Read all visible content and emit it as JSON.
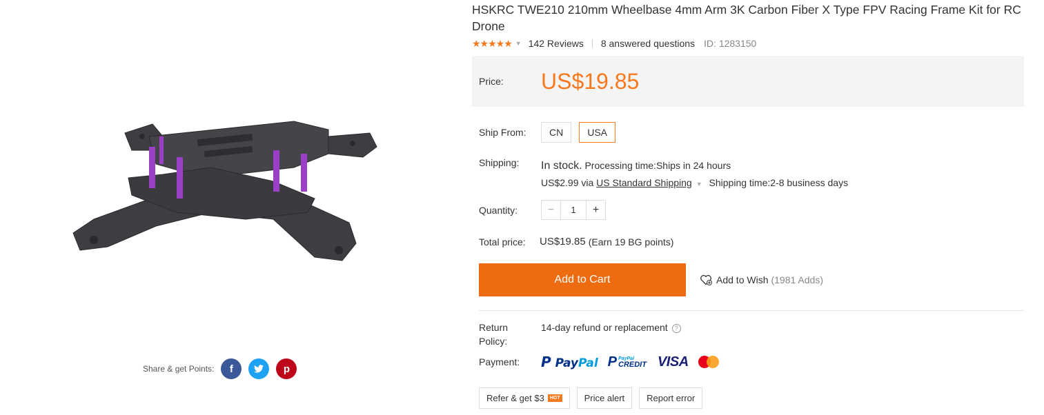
{
  "product": {
    "title": "HSKRC TWE210 210mm Wheelbase 4mm Arm 3K Carbon Fiber X Type FPV Racing Frame Kit for RC Drone",
    "stars": "★★★★★",
    "rating_value": 5,
    "reviews": "142 Reviews",
    "answered": "8 answered questions",
    "id": "ID: 1283150"
  },
  "price": {
    "label": "Price:",
    "value": "US$19.85"
  },
  "ship_from": {
    "label": "Ship From:",
    "options": [
      "CN",
      "USA"
    ],
    "selected": "USA"
  },
  "shipping": {
    "label": "Shipping:",
    "stock": "In stock.",
    "processing": "Processing time:Ships in 24 hours",
    "cost": "US$2.99 via",
    "method": "US Standard Shipping",
    "time": "Shipping time:2-8 business days"
  },
  "quantity": {
    "label": "Quantity:",
    "value": "1",
    "minus": "−",
    "plus": "+"
  },
  "total": {
    "label": "Total price:",
    "value": "US$19.85",
    "points": "(Earn 19 BG points)"
  },
  "actions": {
    "add_to_cart": "Add to Cart",
    "add_to_wish": "Add to Wish",
    "wish_count": "(1981 Adds)"
  },
  "return_policy": {
    "label_line1": "Return",
    "label_line2": "Policy:",
    "text": "14-day refund or replacement",
    "help": "?"
  },
  "payment": {
    "label": "Payment:",
    "paypal_a": "Pay",
    "paypal_b": "Pal",
    "pp_credit_small": "PayPal",
    "pp_credit_big": "CREDIT",
    "visa": "VISA",
    "mastercard": "MasterCard"
  },
  "bottom": {
    "refer": "Refer & get $3",
    "hot": "HOT",
    "price_alert": "Price alert",
    "report_error": "Report error"
  },
  "share": {
    "label": "Share & get Points:",
    "facebook": "f",
    "twitter": "t",
    "pinterest": "p"
  },
  "colors": {
    "accent": "#f7791e",
    "cart_button": "#ee6b10",
    "facebook": "#3b5998",
    "twitter": "#1da1f2",
    "pinterest": "#bd081c"
  }
}
